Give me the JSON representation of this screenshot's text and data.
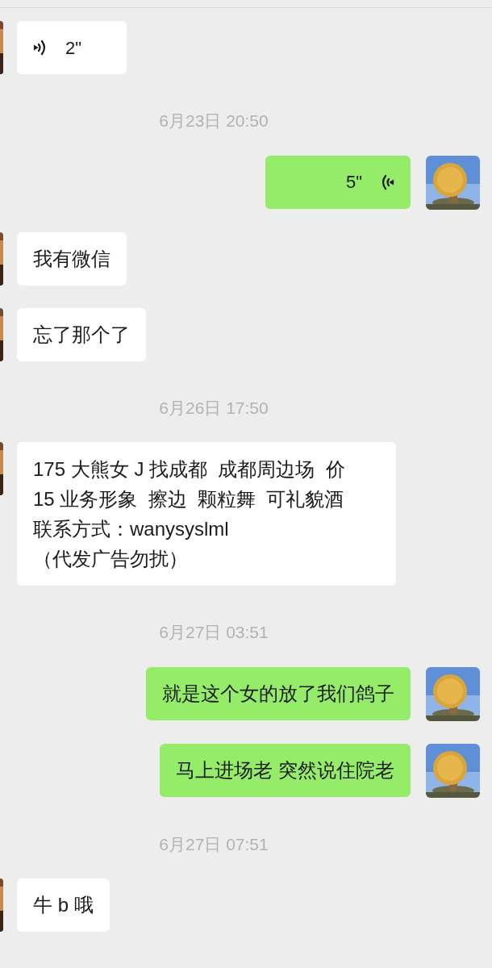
{
  "messages": [
    {
      "kind": "voice",
      "outgoing": false,
      "text": "2\""
    },
    {
      "kind": "time",
      "text": "6月23日 20:50"
    },
    {
      "kind": "voice",
      "outgoing": true,
      "text": "5\""
    },
    {
      "kind": "text",
      "outgoing": false,
      "lines": [
        "我有微信"
      ]
    },
    {
      "kind": "text",
      "outgoing": false,
      "lines": [
        "忘了那个了"
      ]
    },
    {
      "kind": "time",
      "text": "6月26日 17:50"
    },
    {
      "kind": "text",
      "outgoing": false,
      "lines": [
        "175 大熊女 J 找成都  成都周边场  价",
        "15 业务形象  擦边  颗粒舞  可礼貌酒",
        "联系方式：wanysyslml",
        "（代发广告勿扰）"
      ]
    },
    {
      "kind": "time",
      "text": "6月27日 03:51"
    },
    {
      "kind": "text",
      "outgoing": true,
      "lines": [
        "就是这个女的放了我们鸽子"
      ]
    },
    {
      "kind": "text",
      "outgoing": true,
      "lines": [
        "马上进场老 突然说住院老"
      ]
    },
    {
      "kind": "time",
      "text": "6月27日 07:51"
    },
    {
      "kind": "text",
      "outgoing": false,
      "lines": [
        "牛 b 哦"
      ]
    }
  ]
}
